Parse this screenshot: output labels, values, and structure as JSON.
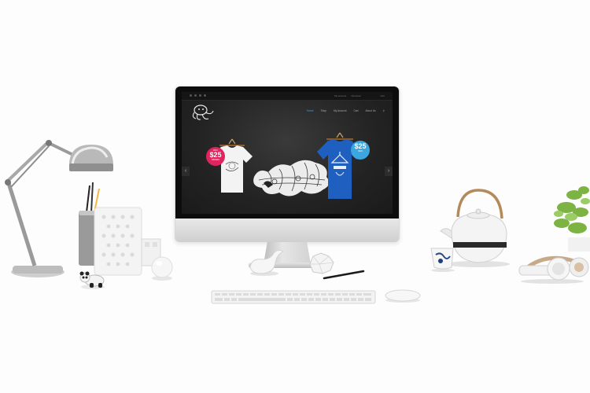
{
  "screen": {
    "topbar_links": [
      "My account",
      "Checkout"
    ],
    "cart_label": "Cart",
    "nav_items": [
      "Home",
      "Shop",
      "My Account",
      "Cart",
      "About Us"
    ],
    "badge_left": {
      "small_text": "ONLY",
      "price": "$25",
      "small_text_bottom": "WOMEN"
    },
    "badge_right": {
      "small_text": "",
      "price": "$25",
      "small_text_bottom": "MEN"
    },
    "arrow_left": "‹",
    "arrow_right": "›"
  },
  "device": {
    "logo_glyph": ""
  },
  "colors": {
    "badge_red": "#e0245e",
    "badge_blue": "#3ba6e0",
    "tshirt_blue": "#1f5fbf",
    "nav_active": "#4aa3df"
  }
}
